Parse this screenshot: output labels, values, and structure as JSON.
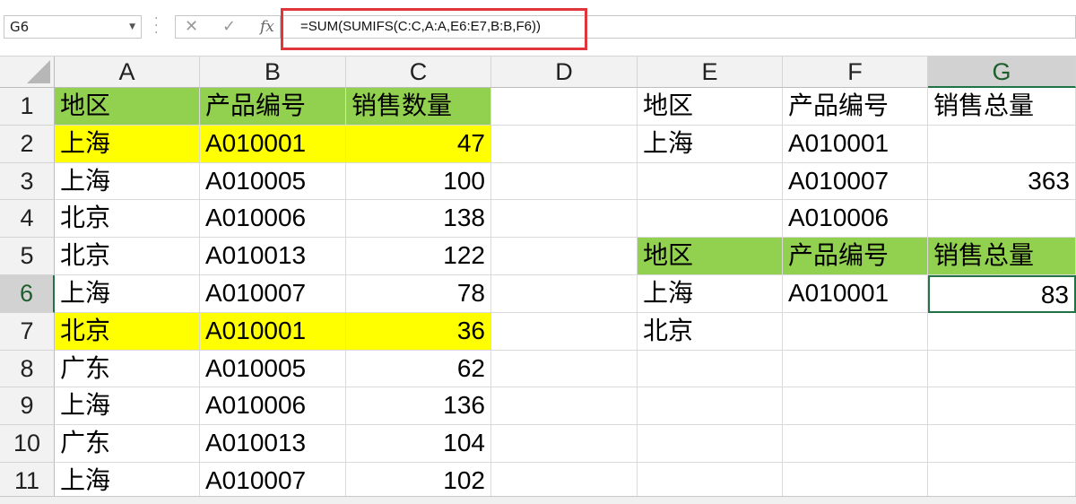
{
  "name_box": "G6",
  "formula_bar": {
    "cancel_icon": "✕",
    "enter_icon": "✓",
    "fx_label": "fx",
    "formula": "=SUM(SUMIFS(C:C,A:A,E6:E7,B:B,F6))"
  },
  "columns": [
    "A",
    "B",
    "C",
    "D",
    "E",
    "F",
    "G"
  ],
  "active_column": "G",
  "rows": [
    "1",
    "2",
    "3",
    "4",
    "5",
    "6",
    "7",
    "8",
    "9",
    "10",
    "11"
  ],
  "active_row": "6",
  "colors": {
    "yellow": "#ffff00",
    "green": "#92d050",
    "selection": "#217346",
    "highlight_box": "#e0353b"
  },
  "cells": {
    "A1": "地区",
    "B1": "产品编号",
    "C1": "销售数量",
    "A2": "上海",
    "B2": "A010001",
    "C2": "47",
    "A3": "上海",
    "B3": "A010005",
    "C3": "100",
    "A4": "北京",
    "B4": "A010006",
    "C4": "138",
    "A5": "北京",
    "B5": "A010013",
    "C5": "122",
    "A6": "上海",
    "B6": "A010007",
    "C6": "78",
    "A7": "北京",
    "B7": "A010001",
    "C7": "36",
    "A8": "广东",
    "B8": "A010005",
    "C8": "62",
    "A9": "上海",
    "B9": "A010006",
    "C9": "136",
    "A10": "广东",
    "B10": "A010013",
    "C10": "104",
    "A11": "上海",
    "B11": "A010007",
    "C11": "102",
    "E1": "地区",
    "F1": "产品编号",
    "G1": "销售总量",
    "E2": "上海",
    "F2": "A010001",
    "F3": "A010007",
    "G3": "363",
    "F4": "A010006",
    "E5": "地区",
    "F5": "产品编号",
    "G5": "销售总量",
    "E6": "上海",
    "F6": "A010001",
    "G6": "83",
    "E7": "北京"
  }
}
